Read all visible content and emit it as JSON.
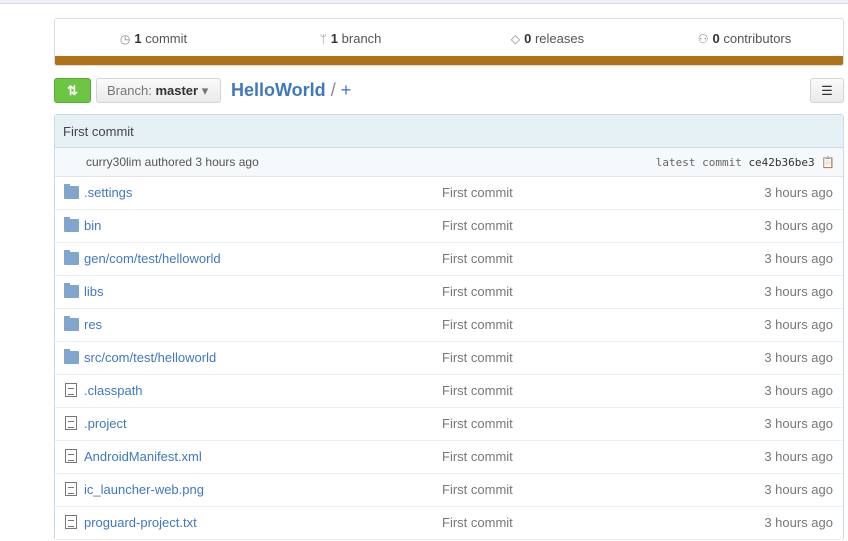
{
  "stats": [
    {
      "icon": "history-icon",
      "count": "1",
      "label": "commit"
    },
    {
      "icon": "branch-icon",
      "count": "1",
      "label": "branch"
    },
    {
      "icon": "tag-icon",
      "count": "0",
      "label": "releases"
    },
    {
      "icon": "contributors-icon",
      "count": "0",
      "label": "contributors"
    }
  ],
  "language_color": "#b07219",
  "toolbar": {
    "branch_prefix": "Branch:",
    "branch": "master",
    "repo": "HelloWorld",
    "sep": "/",
    "plus": "+"
  },
  "commit": {
    "title": "First commit",
    "meta": "curry30lim authored 3 hours ago",
    "sha_label": "latest commit",
    "sha": "ce42b36be3"
  },
  "files": [
    {
      "type": "folder",
      "name": ".settings",
      "msg": "First commit",
      "age": "3 hours ago"
    },
    {
      "type": "folder",
      "name": "bin",
      "msg": "First commit",
      "age": "3 hours ago"
    },
    {
      "type": "folder",
      "name": "gen/com/test/helloworld",
      "msg": "First commit",
      "age": "3 hours ago"
    },
    {
      "type": "folder",
      "name": "libs",
      "msg": "First commit",
      "age": "3 hours ago"
    },
    {
      "type": "folder",
      "name": "res",
      "msg": "First commit",
      "age": "3 hours ago"
    },
    {
      "type": "folder",
      "name": "src/com/test/helloworld",
      "msg": "First commit",
      "age": "3 hours ago"
    },
    {
      "type": "file",
      "name": ".classpath",
      "msg": "First commit",
      "age": "3 hours ago"
    },
    {
      "type": "file",
      "name": ".project",
      "msg": "First commit",
      "age": "3 hours ago"
    },
    {
      "type": "file",
      "name": "AndroidManifest.xml",
      "msg": "First commit",
      "age": "3 hours ago"
    },
    {
      "type": "file",
      "name": "ic_launcher-web.png",
      "msg": "First commit",
      "age": "3 hours ago"
    },
    {
      "type": "file",
      "name": "proguard-project.txt",
      "msg": "First commit",
      "age": "3 hours ago"
    }
  ]
}
